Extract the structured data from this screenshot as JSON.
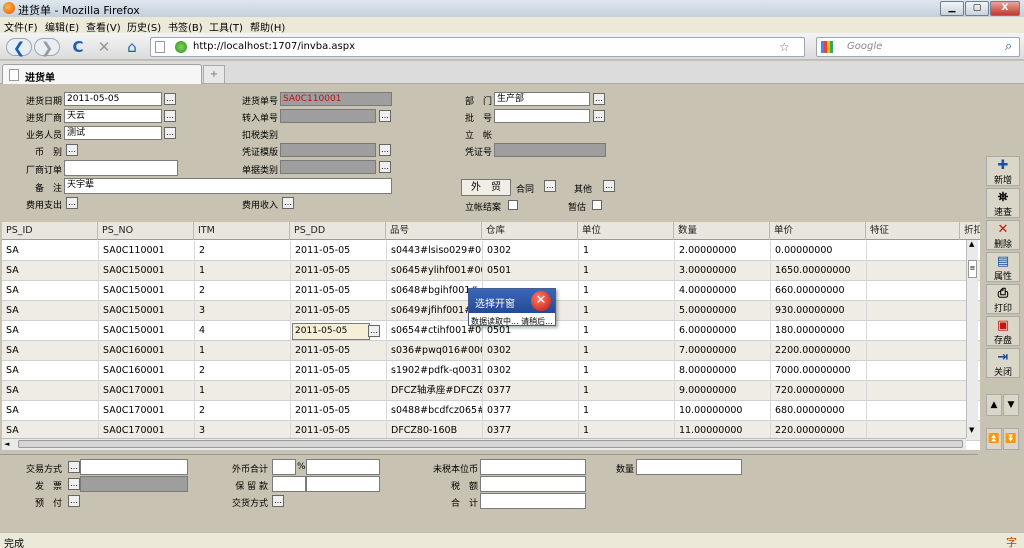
{
  "window": {
    "title": "进货单 - Mozilla Firefox",
    "min": "▁",
    "max": "▢",
    "close": "X"
  },
  "menu": [
    "文件(F)",
    "编辑(E)",
    "查看(V)",
    "历史(S)",
    "书签(B)",
    "工具(T)",
    "帮助(H)"
  ],
  "nav": {
    "back": "❮",
    "forward": "❯",
    "reload": "C",
    "stop": "✕",
    "home": "⌂",
    "url": "http://localhost:1707/invba.aspx",
    "bookmark": "☆",
    "search_placeholder": "Google",
    "search_btn": "⌕"
  },
  "tab": {
    "label": "进货单",
    "new_tab": "+"
  },
  "form": {
    "c1": [
      {
        "label": "进货日期",
        "value": "2011-05-05"
      },
      {
        "label": "进货厂商",
        "value": "天云"
      },
      {
        "label": "业务人员",
        "value": "测试"
      },
      {
        "label": "币　别",
        "value": ""
      },
      {
        "label": "厂商订单",
        "value": ""
      },
      {
        "label": "备　注",
        "value": "天宇辈"
      },
      {
        "label": "费用支出",
        "value": ""
      }
    ],
    "c2": [
      {
        "label": "进货单号",
        "value": "SA0C110001"
      },
      {
        "label": "转入单号",
        "value": ""
      },
      {
        "label": "扣税类别",
        "value": ""
      },
      {
        "label": "凭证模版",
        "value": ""
      },
      {
        "label": "单据类别",
        "value": ""
      },
      {
        "label": "费用收入",
        "value": ""
      }
    ],
    "c3": [
      {
        "label": "部　门",
        "value": "生产部"
      },
      {
        "label": "批　号",
        "value": ""
      },
      {
        "label": "立　帐",
        "value": ""
      },
      {
        "label": "凭证号",
        "value": ""
      }
    ],
    "foreign_btn": "外　贸",
    "contract": "合同",
    "other": "其他",
    "settle": "立帐结案",
    "estimate": "暂估",
    "dd": "…"
  },
  "grid": {
    "headers": [
      "PS_ID",
      "PS_NO",
      "ITM",
      "PS_DD",
      "品号",
      "仓库",
      "单位",
      "数量",
      "单价",
      "特征",
      "折扣"
    ],
    "rows": [
      [
        "SA",
        "SA0C110001",
        "2",
        "2011-05-05",
        "s0443#lsiso029#00(",
        "0302",
        "1",
        "2.00000000",
        "0.00000000",
        ""
      ],
      [
        "SA",
        "SA0C150001",
        "1",
        "2011-05-05",
        "s0645#ylihf001#000",
        "0501",
        "1",
        "3.00000000",
        "1650.00000000",
        ""
      ],
      [
        "SA",
        "SA0C150001",
        "2",
        "2011-05-05",
        "s0648#bgihf001#",
        "",
        "1",
        "4.00000000",
        "660.00000000",
        ""
      ],
      [
        "SA",
        "SA0C150001",
        "3",
        "2011-05-05",
        "s0649#jfihf001#",
        "",
        "1",
        "5.00000000",
        "930.00000000",
        ""
      ],
      [
        "SA",
        "SA0C150001",
        "4",
        "2011-05-05",
        "s0654#ctihf001#00(",
        "0501",
        "1",
        "6.00000000",
        "180.00000000",
        ""
      ],
      [
        "SA",
        "SA0C160001",
        "1",
        "2011-05-05",
        "s036#pwq016#000(",
        "0302",
        "1",
        "7.00000000",
        "2200.00000000",
        ""
      ],
      [
        "SA",
        "SA0C160001",
        "2",
        "2011-05-05",
        "s1902#pdfk-q0031#",
        "0302",
        "1",
        "8.00000000",
        "7000.00000000",
        ""
      ],
      [
        "SA",
        "SA0C170001",
        "1",
        "2011-05-05",
        "DFCZ轴承座#DFCZ8(",
        "0377",
        "1",
        "9.00000000",
        "720.00000000",
        ""
      ],
      [
        "SA",
        "SA0C170001",
        "2",
        "2011-05-05",
        "s0488#bcdfcz065#(",
        "0377",
        "1",
        "10.00000000",
        "680.00000000",
        ""
      ],
      [
        "SA",
        "SA0C170001",
        "3",
        "2011-05-05",
        "DFCZ80-160B",
        "0377",
        "1",
        "11.00000000",
        "220.00000000",
        ""
      ]
    ],
    "scroll_up": "▲",
    "scroll_down": "▼",
    "scroll_left": "◄",
    "scroll_right": "►",
    "thumb": "≡"
  },
  "popup": {
    "title": "选择开窗",
    "close": "✕",
    "message": "数据读取中... 请稍后..."
  },
  "toolbar": [
    {
      "icon": "✚",
      "label": "新增"
    },
    {
      "icon": "⛯",
      "label": "速查"
    },
    {
      "icon": "✕",
      "label": "删除"
    },
    {
      "icon": "▤",
      "label": "属性"
    },
    {
      "icon": "⎙",
      "label": "打印"
    },
    {
      "icon": "▣",
      "label": "存盘"
    },
    {
      "icon": "⇥",
      "label": "关闭"
    }
  ],
  "nav_arrows": {
    "up": "▲",
    "down": "▼",
    "first": "⏫",
    "last": "⏬"
  },
  "footer": {
    "trade_label": "交易方式",
    "invoice_label": "发　票",
    "prepay_label": "预　付",
    "fx_label": "外币合计",
    "percent": "%",
    "retain_label": "保 留 款",
    "delivery_label": "交货方式",
    "untaxed_label": "未税本位币",
    "tax_label": "税　额",
    "total_label": "合　计",
    "qty_label": "数量"
  },
  "status": {
    "text": "完成",
    "ime": "字"
  }
}
